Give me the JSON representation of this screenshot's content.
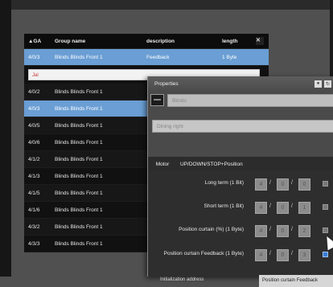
{
  "table": {
    "headers": {
      "ga": "▲GA",
      "name": "Group name",
      "desc": "description",
      "len": "length"
    },
    "close_glyph": "✕",
    "rows": [
      {
        "ga": "4/0/3",
        "name": "Blinds Blinds Front 1",
        "desc": "Feedback",
        "len": "1 Byte",
        "selected": true
      },
      {
        "ga": "4/0/2",
        "name": "Blinds Blinds Front 1",
        "desc": "",
        "len": ""
      },
      {
        "ga": "4/0/3",
        "name": "Blinds Blinds Front 1",
        "desc": "",
        "len": "",
        "selected": true
      },
      {
        "ga": "4/0/5",
        "name": "Blinds Blinds Front 1",
        "desc": "",
        "len": ""
      },
      {
        "ga": "4/0/6",
        "name": "Blinds Blinds Front 1",
        "desc": "",
        "len": ""
      },
      {
        "ga": "4/1/2",
        "name": "Blinds Blinds Front 1",
        "desc": "",
        "len": ""
      },
      {
        "ga": "4/1/3",
        "name": "Blinds Blinds Front 1",
        "desc": "",
        "len": ""
      },
      {
        "ga": "4/1/5",
        "name": "Blinds Blinds Front 1",
        "desc": "",
        "len": ""
      },
      {
        "ga": "4/1/6",
        "name": "Blinds Blinds Front 1",
        "desc": "",
        "len": ""
      },
      {
        "ga": "4/3/2",
        "name": "Blinds Blinds Front 1",
        "desc": "",
        "len": ""
      },
      {
        "ga": "4/3/3",
        "name": "Blinds Blinds Front 1",
        "desc": "",
        "len": ""
      }
    ],
    "input_value": "Jal"
  },
  "dialog": {
    "title": "Properties",
    "name_field": "Blinds",
    "room_field": "Dining right",
    "motor_label": "Motor",
    "motor_value": "UP/DOWN/STOP+Position",
    "props": [
      {
        "label": "Long term (1 Bit)",
        "ga": [
          "4",
          "0",
          "0"
        ],
        "checked": false
      },
      {
        "label": "Short term (1 Bit)",
        "ga": [
          "4",
          "0",
          "1"
        ],
        "checked": false
      },
      {
        "label": "Position curtain (%) (1 Byte)",
        "ga": [
          "4",
          "0",
          "2"
        ],
        "checked": false
      },
      {
        "label": "Position curtain Feedback (1 Byte)",
        "ga": [
          "4",
          "0",
          "3"
        ],
        "checked": true
      }
    ],
    "init_label": "Initialization address",
    "init_value": "Position curtain Feedback"
  },
  "colors": {
    "selection": "#6a9ed4",
    "check": "#3a7bd5"
  }
}
